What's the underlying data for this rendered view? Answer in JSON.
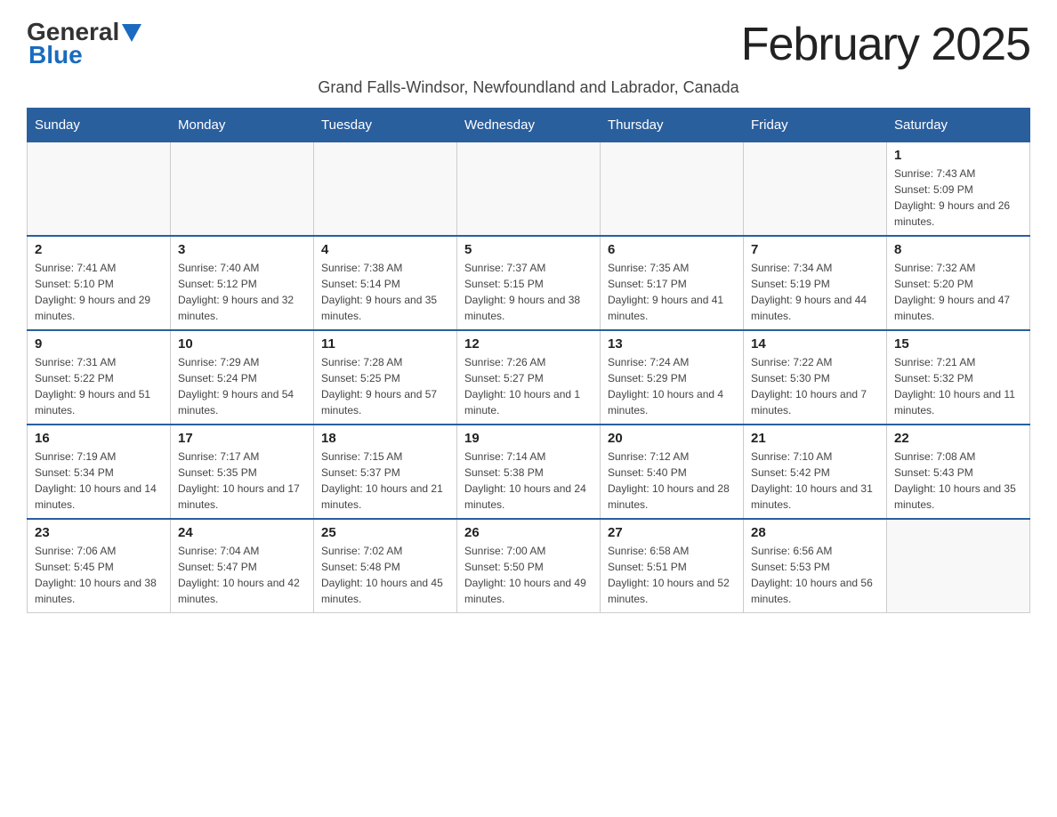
{
  "header": {
    "logo_general": "General",
    "logo_blue": "Blue",
    "title": "February 2025",
    "subtitle": "Grand Falls-Windsor, Newfoundland and Labrador, Canada"
  },
  "days_of_week": [
    "Sunday",
    "Monday",
    "Tuesday",
    "Wednesday",
    "Thursday",
    "Friday",
    "Saturday"
  ],
  "weeks": [
    {
      "days": [
        {
          "number": "",
          "info": ""
        },
        {
          "number": "",
          "info": ""
        },
        {
          "number": "",
          "info": ""
        },
        {
          "number": "",
          "info": ""
        },
        {
          "number": "",
          "info": ""
        },
        {
          "number": "",
          "info": ""
        },
        {
          "number": "1",
          "info": "Sunrise: 7:43 AM\nSunset: 5:09 PM\nDaylight: 9 hours and 26 minutes."
        }
      ]
    },
    {
      "days": [
        {
          "number": "2",
          "info": "Sunrise: 7:41 AM\nSunset: 5:10 PM\nDaylight: 9 hours and 29 minutes."
        },
        {
          "number": "3",
          "info": "Sunrise: 7:40 AM\nSunset: 5:12 PM\nDaylight: 9 hours and 32 minutes."
        },
        {
          "number": "4",
          "info": "Sunrise: 7:38 AM\nSunset: 5:14 PM\nDaylight: 9 hours and 35 minutes."
        },
        {
          "number": "5",
          "info": "Sunrise: 7:37 AM\nSunset: 5:15 PM\nDaylight: 9 hours and 38 minutes."
        },
        {
          "number": "6",
          "info": "Sunrise: 7:35 AM\nSunset: 5:17 PM\nDaylight: 9 hours and 41 minutes."
        },
        {
          "number": "7",
          "info": "Sunrise: 7:34 AM\nSunset: 5:19 PM\nDaylight: 9 hours and 44 minutes."
        },
        {
          "number": "8",
          "info": "Sunrise: 7:32 AM\nSunset: 5:20 PM\nDaylight: 9 hours and 47 minutes."
        }
      ]
    },
    {
      "days": [
        {
          "number": "9",
          "info": "Sunrise: 7:31 AM\nSunset: 5:22 PM\nDaylight: 9 hours and 51 minutes."
        },
        {
          "number": "10",
          "info": "Sunrise: 7:29 AM\nSunset: 5:24 PM\nDaylight: 9 hours and 54 minutes."
        },
        {
          "number": "11",
          "info": "Sunrise: 7:28 AM\nSunset: 5:25 PM\nDaylight: 9 hours and 57 minutes."
        },
        {
          "number": "12",
          "info": "Sunrise: 7:26 AM\nSunset: 5:27 PM\nDaylight: 10 hours and 1 minute."
        },
        {
          "number": "13",
          "info": "Sunrise: 7:24 AM\nSunset: 5:29 PM\nDaylight: 10 hours and 4 minutes."
        },
        {
          "number": "14",
          "info": "Sunrise: 7:22 AM\nSunset: 5:30 PM\nDaylight: 10 hours and 7 minutes."
        },
        {
          "number": "15",
          "info": "Sunrise: 7:21 AM\nSunset: 5:32 PM\nDaylight: 10 hours and 11 minutes."
        }
      ]
    },
    {
      "days": [
        {
          "number": "16",
          "info": "Sunrise: 7:19 AM\nSunset: 5:34 PM\nDaylight: 10 hours and 14 minutes."
        },
        {
          "number": "17",
          "info": "Sunrise: 7:17 AM\nSunset: 5:35 PM\nDaylight: 10 hours and 17 minutes."
        },
        {
          "number": "18",
          "info": "Sunrise: 7:15 AM\nSunset: 5:37 PM\nDaylight: 10 hours and 21 minutes."
        },
        {
          "number": "19",
          "info": "Sunrise: 7:14 AM\nSunset: 5:38 PM\nDaylight: 10 hours and 24 minutes."
        },
        {
          "number": "20",
          "info": "Sunrise: 7:12 AM\nSunset: 5:40 PM\nDaylight: 10 hours and 28 minutes."
        },
        {
          "number": "21",
          "info": "Sunrise: 7:10 AM\nSunset: 5:42 PM\nDaylight: 10 hours and 31 minutes."
        },
        {
          "number": "22",
          "info": "Sunrise: 7:08 AM\nSunset: 5:43 PM\nDaylight: 10 hours and 35 minutes."
        }
      ]
    },
    {
      "days": [
        {
          "number": "23",
          "info": "Sunrise: 7:06 AM\nSunset: 5:45 PM\nDaylight: 10 hours and 38 minutes."
        },
        {
          "number": "24",
          "info": "Sunrise: 7:04 AM\nSunset: 5:47 PM\nDaylight: 10 hours and 42 minutes."
        },
        {
          "number": "25",
          "info": "Sunrise: 7:02 AM\nSunset: 5:48 PM\nDaylight: 10 hours and 45 minutes."
        },
        {
          "number": "26",
          "info": "Sunrise: 7:00 AM\nSunset: 5:50 PM\nDaylight: 10 hours and 49 minutes."
        },
        {
          "number": "27",
          "info": "Sunrise: 6:58 AM\nSunset: 5:51 PM\nDaylight: 10 hours and 52 minutes."
        },
        {
          "number": "28",
          "info": "Sunrise: 6:56 AM\nSunset: 5:53 PM\nDaylight: 10 hours and 56 minutes."
        },
        {
          "number": "",
          "info": ""
        }
      ]
    }
  ]
}
